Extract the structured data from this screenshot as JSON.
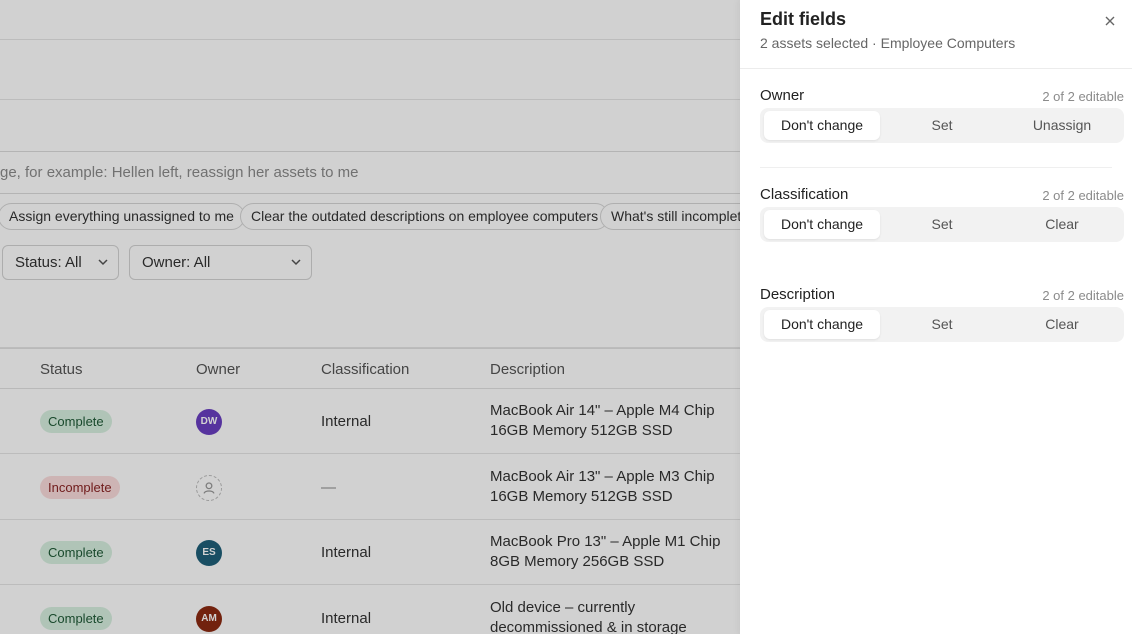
{
  "background": {
    "search_placeholder": "ge, for example: Hellen left, reassign her assets to me",
    "suggestions": [
      "Assign everything unassigned to me",
      "Clear the outdated descriptions on employee computers",
      "What's still incomplete"
    ],
    "filters": {
      "status": "Status: All",
      "owner": "Owner: All"
    },
    "table": {
      "headers": [
        "Status",
        "Owner",
        "Classification",
        "Description"
      ],
      "rows": [
        {
          "status": "Complete",
          "owner_initials": "DW",
          "owner_color": "#6a3fc1",
          "classification": "Internal",
          "desc1": "MacBook Air 14\" – Apple M4 Chip",
          "desc2": "16GB Memory 512GB SSD"
        },
        {
          "status": "Incomplete",
          "owner_initials": "",
          "owner_color": "",
          "classification": "—",
          "desc1": "MacBook Air 13\" – Apple M3 Chip",
          "desc2": "16GB Memory 512GB SSD"
        },
        {
          "status": "Complete",
          "owner_initials": "ES",
          "owner_color": "#1f6079",
          "classification": "Internal",
          "desc1": "MacBook Pro 13\" – Apple M1 Chip",
          "desc2": "8GB Memory 256GB SSD"
        },
        {
          "status": "Complete",
          "owner_initials": "AM",
          "owner_color": "#8c2a12",
          "classification": "Internal",
          "desc1": "Old device – currently",
          "desc2": "decommissioned & in storage"
        }
      ]
    }
  },
  "panel": {
    "title": "Edit fields",
    "subtitle": "2 assets selected · Employee Computers",
    "sections": [
      {
        "label": "Owner",
        "meta": "2 of 2 editable",
        "options": [
          "Don't change",
          "Set",
          "Unassign"
        ],
        "selected": "Don't change"
      },
      {
        "label": "Classification",
        "meta": "2 of 2 editable",
        "options": [
          "Don't change",
          "Set",
          "Clear"
        ],
        "selected": "Don't change"
      },
      {
        "label": "Description",
        "meta": "2 of 2 editable",
        "options": [
          "Don't change",
          "Set",
          "Clear"
        ],
        "selected": "Don't change"
      }
    ]
  },
  "colors": {
    "complete_bg": "#d7f0e0",
    "incomplete_bg": "#fbdcdc",
    "overlay": "rgba(0,0,0,0.18)"
  }
}
